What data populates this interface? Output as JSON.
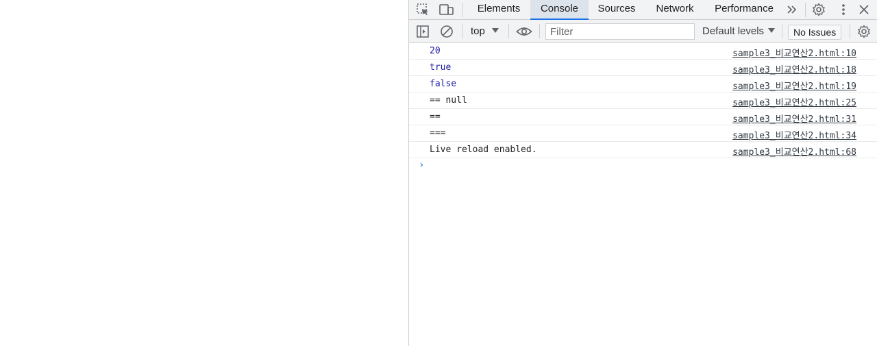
{
  "tabs": [
    {
      "label": "Elements"
    },
    {
      "label": "Console"
    },
    {
      "label": "Sources"
    },
    {
      "label": "Network"
    },
    {
      "label": "Performance"
    }
  ],
  "toolbar": {
    "context": "top",
    "filter_placeholder": "Filter",
    "levels": "Default levels",
    "issues": "No Issues"
  },
  "console": {
    "rows": [
      {
        "text": "20",
        "source": "sample3_비교연산2.html:10"
      },
      {
        "text": "true",
        "source": "sample3_비교연산2.html:18"
      },
      {
        "text": "false",
        "source": "sample3_비교연산2.html:19"
      },
      {
        "text": "== null",
        "source": "sample3_비교연산2.html:25"
      },
      {
        "text": "==",
        "source": "sample3_비교연산2.html:31"
      },
      {
        "text": "===",
        "source": "sample3_비교연산2.html:34"
      },
      {
        "text": "Live reload enabled.",
        "source": "sample3_비교연산2.html:68"
      }
    ],
    "prompt": "›"
  },
  "colors": {
    "accent": "#1a73e8",
    "value_blue": "#1a1aa6",
    "panel_bg": "#f1f3f4"
  }
}
